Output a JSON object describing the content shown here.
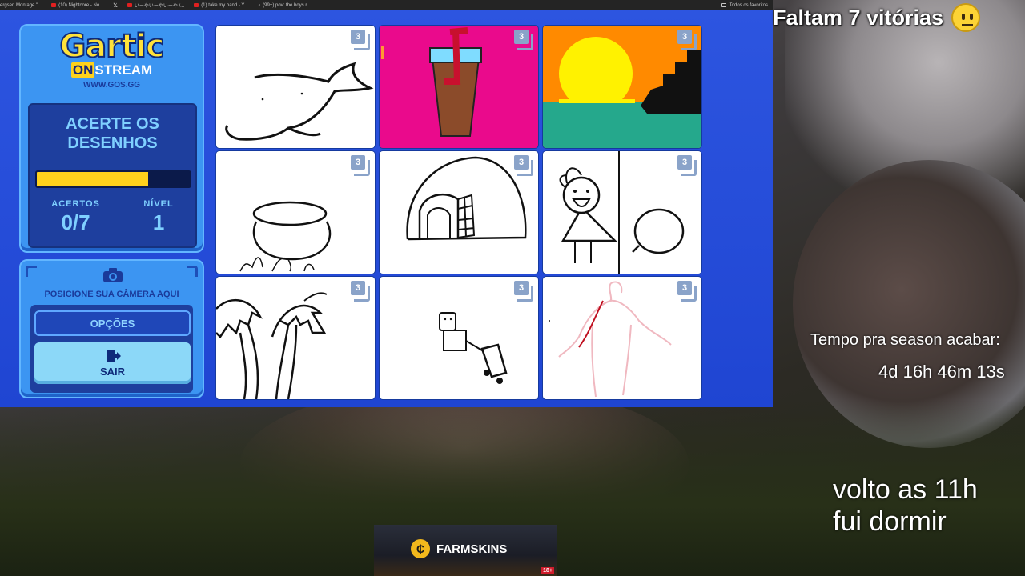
{
  "browser": {
    "bookmarks": [
      {
        "label": "ergsen Montage \"...",
        "icon": "none"
      },
      {
        "label": "(10) Nightcore - No...",
        "icon": "youtube"
      },
      {
        "label": "",
        "icon": "x"
      },
      {
        "label": "いーやいーやいーや /...",
        "icon": "youtube"
      },
      {
        "label": "(1) take my hand - Y...",
        "icon": "youtube"
      },
      {
        "label": "(99+) pov: the boys r...",
        "icon": "tiktok"
      }
    ],
    "favorites_label": "Todos os favoritos"
  },
  "game": {
    "logo_title": "Gartic",
    "logo_on": "ON",
    "logo_stream": "STREAM",
    "logo_url": "WWW.GOS.GG",
    "mode_title": "ACERTE OS DESENHOS",
    "progress": 0.73,
    "hits_label": "ACERTOS",
    "hits_value": "0/7",
    "level_label": "NÍVEL",
    "level_value": "1",
    "camera_label": "POSICIONE SUA CÂMERA AQUI",
    "options_button": "OPÇÕES",
    "exit_button": "SAIR",
    "drawings": [
      {
        "badge": "3",
        "subject": "whale"
      },
      {
        "badge": "3",
        "subject": "drink-cup"
      },
      {
        "badge": "3",
        "subject": "sunset-ship"
      },
      {
        "badge": "3",
        "subject": "cauldron"
      },
      {
        "badge": "3",
        "subject": "igloo"
      },
      {
        "badge": "3",
        "subject": "girl-speech-bubble"
      },
      {
        "badge": "3",
        "subject": "palm-trees"
      },
      {
        "badge": "3",
        "subject": "person-with-box"
      },
      {
        "badge": "3",
        "subject": "human-figure"
      }
    ]
  },
  "overlay": {
    "wins_text": "Faltam 7 vitórias",
    "season_label": "Tempo pra season acabar:",
    "season_timer": "4d 16h 46m 13s",
    "note_line1": "volto as 11h",
    "note_line2": "fui dormir",
    "sponsor": "FARMSKINS",
    "sponsor_age": "18+"
  },
  "colors": {
    "game_bg": "#2d55e0",
    "card": "#3c95f2",
    "accent_yellow": "#ffd21c",
    "text_light_blue": "#7fd0ff"
  }
}
